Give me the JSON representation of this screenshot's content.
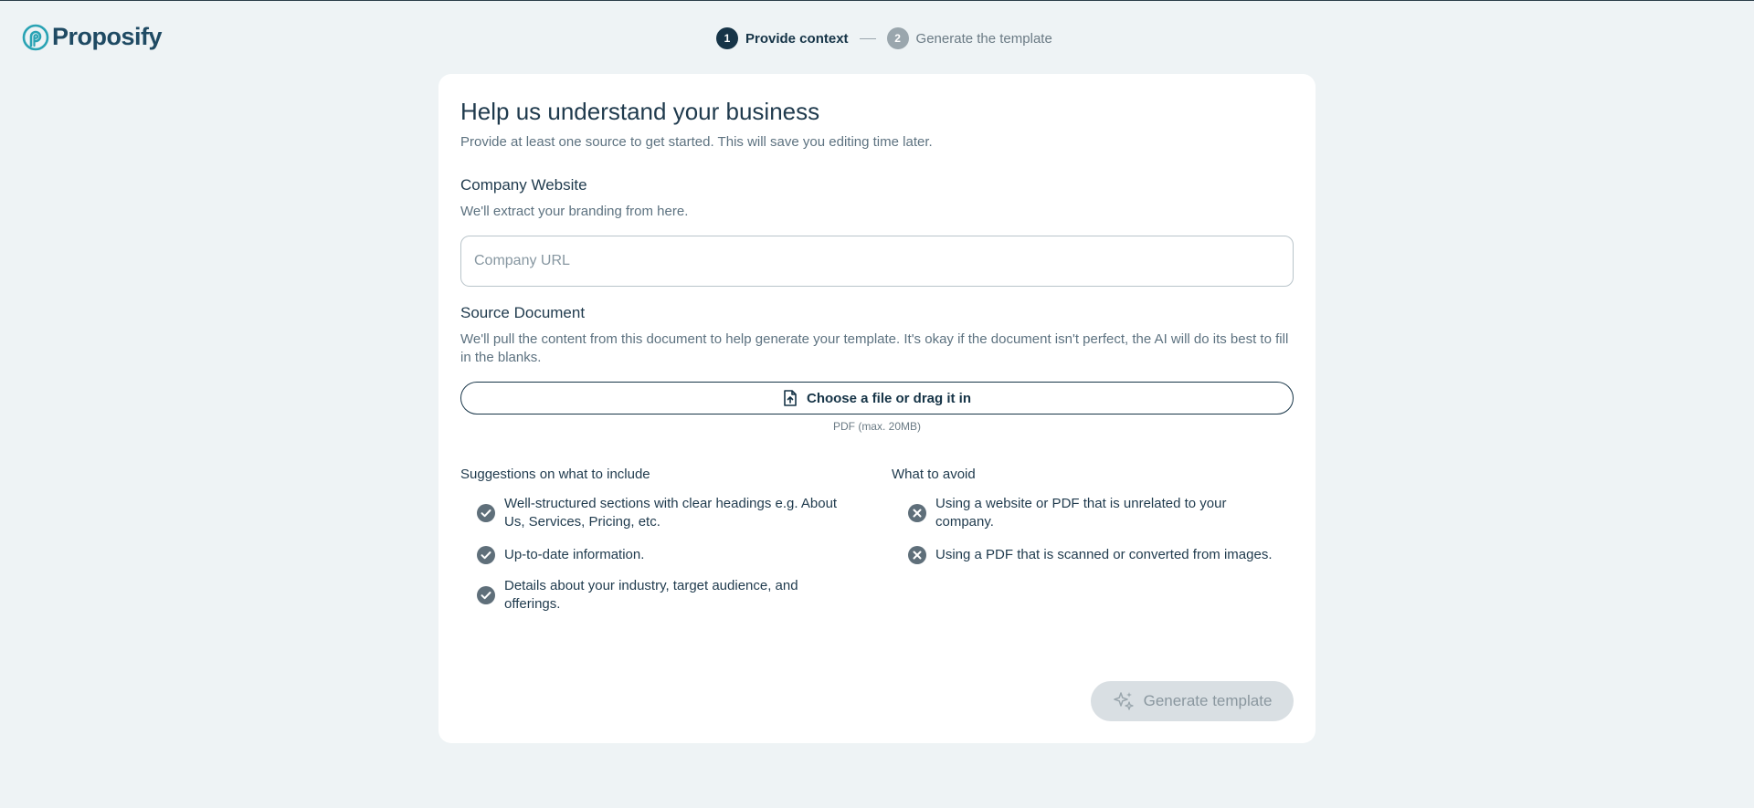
{
  "brand": {
    "name": "Proposify"
  },
  "stepper": {
    "steps": [
      {
        "number": "1",
        "label": "Provide context",
        "state": "active"
      },
      {
        "number": "2",
        "label": "Generate the template",
        "state": "inactive"
      }
    ]
  },
  "form": {
    "title": "Help us understand your business",
    "subtitle": "Provide at least one source to get started. This will save you editing time later.",
    "website": {
      "label": "Company Website",
      "help": "We'll extract your branding from here.",
      "placeholder": "Company URL",
      "value": ""
    },
    "source": {
      "label": "Source Document",
      "help": "We'll pull the content from this document to help generate your template. It's okay if the document isn't perfect, the AI will do its best to fill in the blanks.",
      "button_label": "Choose a file or drag it in",
      "hint": "PDF (max. 20MB)"
    },
    "suggestions": {
      "title": "Suggestions on what to include",
      "items": [
        "Well-structured sections with clear headings e.g. About Us, Services, Pricing, etc.",
        "Up-to-date information.",
        "Details about your industry, target audience, and offerings."
      ]
    },
    "avoid": {
      "title": "What to avoid",
      "items": [
        "Using a website or PDF that is unrelated to your company.",
        "Using a PDF that is scanned or converted from images."
      ]
    },
    "generate_button": "Generate template"
  },
  "colors": {
    "background": "#eef3f5",
    "primary": "#163447",
    "disabled_button": "#d9dfe3",
    "check_icon": "#5f6f7a"
  },
  "icons": {
    "logo": "proposify-logo-icon",
    "file": "file-upload-icon",
    "check": "check-circle-icon",
    "cross": "x-circle-icon",
    "sparkle": "sparkle-icon"
  }
}
